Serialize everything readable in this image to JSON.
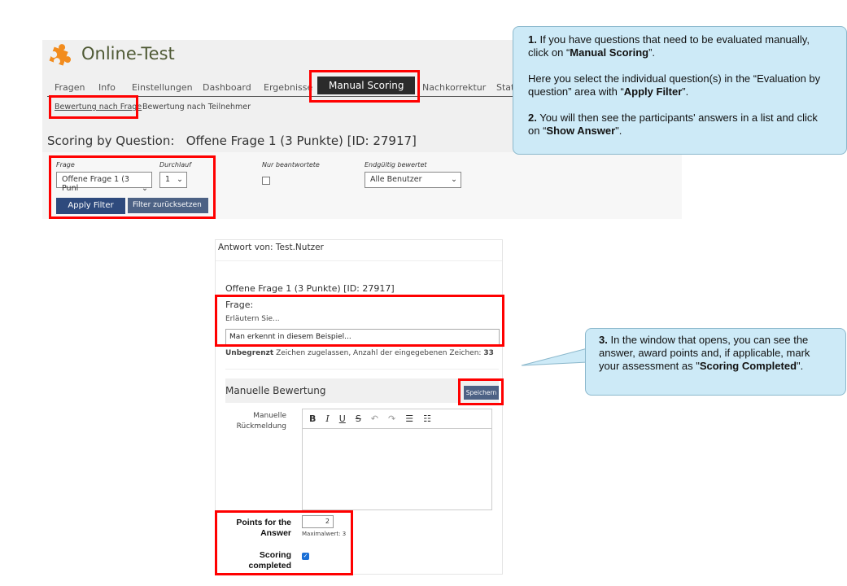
{
  "app": {
    "title": "Online-Test",
    "logo_icon": "puzzle-icon"
  },
  "tabs": [
    {
      "label": "Fragen"
    },
    {
      "label": "Info"
    },
    {
      "label": "Einstellungen"
    },
    {
      "label": "Dashboard"
    },
    {
      "label": "Ergebnisse"
    },
    {
      "label": "Manual Scoring",
      "active": true
    },
    {
      "label": "Nachkorrektur"
    },
    {
      "label": "Stati"
    }
  ],
  "subtabs": [
    {
      "label": "Bewertung nach Frage"
    },
    {
      "label": "Bewertung nach Teilnehmer"
    }
  ],
  "heading": {
    "prefix": "Scoring by Question:",
    "question": "Offene Frage 1 (3 Punkte) [ID: 27917]"
  },
  "filter": {
    "frage_label": "Frage",
    "frage_value": "Offene Frage 1 (3 Punl",
    "durchlauf_label": "Durchlauf",
    "durchlauf_value": "1",
    "nur_label": "Nur beantwortete",
    "nur_checked": false,
    "endg_label": "Endgültig bewertet",
    "endg_value": "Alle Benutzer",
    "apply": "Apply Filter",
    "reset": "Filter zurücksetzen"
  },
  "answer": {
    "from_label": "Antwort von:",
    "from_user": "Test.Nutzer",
    "question_title": "Offene Frage 1 (3 Punkte) [ID: 27917]",
    "frage_label": "Frage:",
    "frage_text": "Erläutern Sie...",
    "answer_text": "Man erkennt in diesem Beispiel...",
    "limit_bold": "Unbegrenzt",
    "limit_text": " Zeichen zugelassen, Anzahl der eingegebenen Zeichen: ",
    "count": "33",
    "manual_heading": "Manuelle Bewertung",
    "save": "Speichern",
    "feedback_label": "Manuelle Rückmeldung",
    "points_label": "Points for the Answer",
    "points_value": "2",
    "max_label": "Maximalwert: 3",
    "completed_label": "Scoring completed",
    "completed_checked": true
  },
  "callouts": {
    "c1": {
      "n1": "1.",
      "t1a": " If you have questions that need to be evaluated manually, click on “",
      "b1": "Manual Scoring",
      "t1b": "”.",
      "t2a": "Here you select the individual question(s) in the “Evaluation by question” area with “",
      "b2": "Apply  Filter",
      "t2b": "”.",
      "n2": "2.",
      "t3a": " You will then see the participants' answers in a list and click on “",
      "b3": "Show Answer",
      "t3b": "\"."
    },
    "c3": {
      "n": "3.",
      "ta": " In the window that opens, you can see the answer, award points and, if applicable, mark your assessment as \"",
      "b": "Scoring Completed",
      "tb": "\"."
    }
  },
  "colors": {
    "highlight": "#ff0000",
    "callout_bg": "#cdeaf7",
    "primary_button": "#2e4a7d",
    "secondary_button": "#4d6285",
    "active_tab": "#2b2b2b"
  }
}
